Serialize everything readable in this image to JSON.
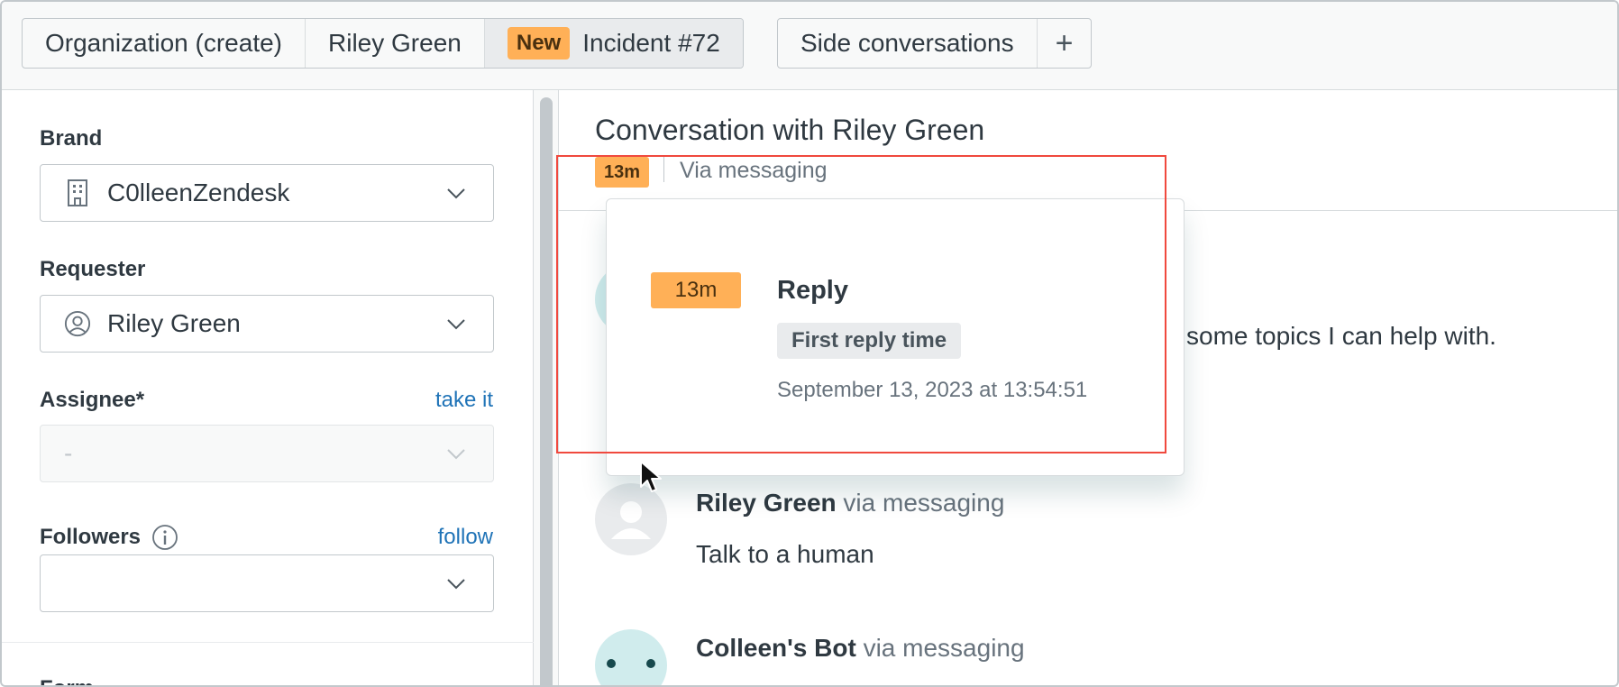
{
  "tabs": {
    "organization": "Organization (create)",
    "riley": "Riley Green",
    "incident_badge": "New",
    "incident": "Incident #72",
    "side_conversations": "Side conversations",
    "add": "+"
  },
  "sidebar": {
    "brand_label": "Brand",
    "brand_value": "C0lleenZendesk",
    "requester_label": "Requester",
    "requester_value": "Riley Green",
    "assignee_label": "Assignee*",
    "assignee_link": "take it",
    "assignee_value": "-",
    "followers_label": "Followers",
    "followers_link": "follow",
    "followers_value": "",
    "form_label": "Form"
  },
  "conversation": {
    "title": "Conversation with Riley Green",
    "timer": "13m",
    "channel": "Via messaging",
    "partial_message": "some topics I can help with.",
    "messages": [
      {
        "author": "Riley Green",
        "via": " via messaging",
        "body": "Talk to a human"
      },
      {
        "author": "Colleen's Bot",
        "via": " via messaging",
        "body": ""
      }
    ]
  },
  "popover": {
    "timer": "13m",
    "title": "Reply",
    "tag": "First reply time",
    "date": "September 13, 2023 at 13:54:51"
  },
  "colors": {
    "accent_link": "#1f73b7",
    "sla_badge": "#ffb057",
    "highlight": "#f0493e"
  }
}
